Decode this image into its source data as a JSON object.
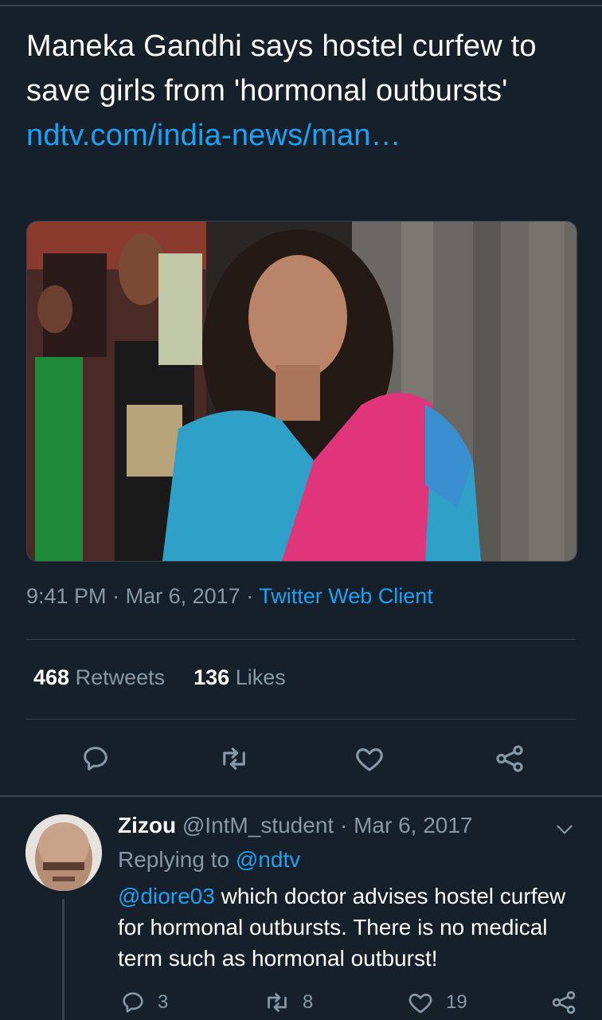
{
  "tweet": {
    "text": "Maneka Gandhi says hostel curfew to save girls from 'hormonal outbursts'",
    "link": "ndtv.com/india-news/man…",
    "time": "9:41 PM",
    "date": "Mar 6, 2017",
    "separator": "·",
    "client": "Twitter Web Client",
    "retweets_count": "468",
    "retweets_label": "Retweets",
    "likes_count": "136",
    "likes_label": "Likes"
  },
  "actions": {
    "reply_icon": "reply-icon",
    "retweet_icon": "retweet-icon",
    "like_icon": "heart-icon",
    "share_icon": "share-icon"
  },
  "reply": {
    "name": "Zizou",
    "handle": "@IntM_student",
    "separator": "·",
    "date": "Mar 6, 2017",
    "replying_to_label": "Replying to",
    "replying_to_handle": "@ndtv",
    "mention": "@diore03",
    "text": "which doctor advises hostel curfew for hormonal outbursts. There is no medical term such as hormonal outburst!",
    "reply_count": "3",
    "retweet_count": "8",
    "like_count": "19"
  },
  "colors": {
    "background": "#15202b",
    "accent": "#1da1f2",
    "secondary_text": "#8899a6",
    "divider": "#38444d"
  }
}
